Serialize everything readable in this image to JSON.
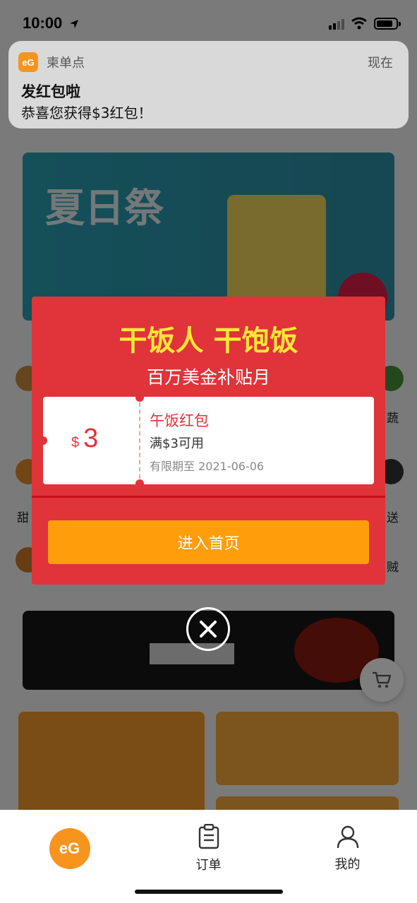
{
  "status_bar": {
    "time": "10:00"
  },
  "notification": {
    "app_name": "柬单点",
    "time": "现在",
    "title": "发红包啦",
    "body": "恭喜您获得$3红包！",
    "app_icon_text": "eG"
  },
  "background": {
    "banner_top_title": "夏日祭",
    "side_labels": [
      "甜",
      "蔬",
      "送",
      "贼"
    ]
  },
  "modal": {
    "headline": "干饭人 干饱饭",
    "subtitle": "百万美金补贴月",
    "coupon": {
      "currency": "$",
      "amount": "3",
      "name": "午饭红包",
      "condition": "满$3可用",
      "expiry": "有限期至 2021-06-06"
    },
    "cta_label": "进入首页"
  },
  "tabbar": {
    "home_logo": "eG",
    "orders_label": "订单",
    "mine_label": "我的"
  },
  "colors": {
    "modal_red": "#e0333a",
    "headline_yellow": "#ffe63a",
    "cta_orange": "#ff9d0b",
    "brand_orange": "#f7941d"
  }
}
